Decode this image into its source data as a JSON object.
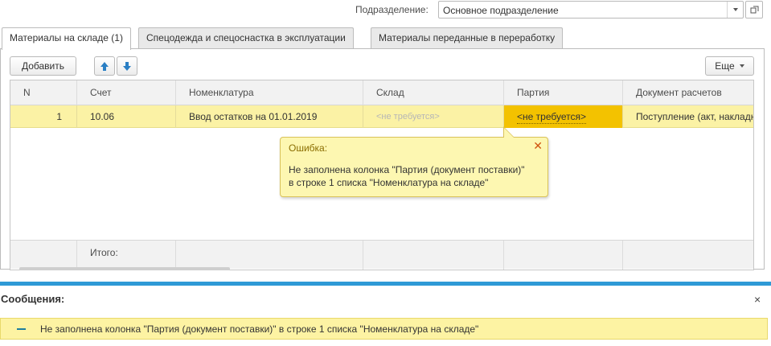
{
  "header": {
    "department_label": "Подразделение:",
    "department_value": "Основное подразделение"
  },
  "tabs": [
    {
      "label": "Материалы на складе (1)",
      "active": true
    },
    {
      "label": "Спецодежда и спецоснастка в эксплуатации",
      "active": false
    },
    {
      "label": "Материалы переданные в переработку",
      "active": false
    }
  ],
  "toolbar": {
    "add_label": "Добавить",
    "more_label": "Еще",
    "up_icon": "arrow-up-icon",
    "down_icon": "arrow-down-icon"
  },
  "table": {
    "columns": [
      "N",
      "Счет",
      "Номенклатура",
      "Склад",
      "Партия",
      "Документ расчетов"
    ],
    "rows": [
      {
        "n": "1",
        "account": "10.06",
        "nomenclature": "Ввод остатков на 01.01.2019",
        "warehouse": "<не требуется>",
        "batch": "<не требуется>",
        "settlement_doc": "Поступление (акт, накладная"
      }
    ],
    "footer_label": "Итого:"
  },
  "error_balloon": {
    "title": "Ошибка:",
    "line1": "Не заполнена колонка \"Партия (документ поставки)\"",
    "line2": "в строке 1 списка \"Номенклатура на складе\""
  },
  "messages": {
    "title": "Сообщения:",
    "items": [
      "Не заполнена колонка \"Партия (документ поставки)\" в строке 1 списка \"Номенклатура на складе\""
    ]
  },
  "colors": {
    "accent": "#2e9ad6",
    "row_highlight": "#fbf2a5",
    "active_cell": "#f3c200",
    "arrow_blue": "#2a7fc4"
  }
}
